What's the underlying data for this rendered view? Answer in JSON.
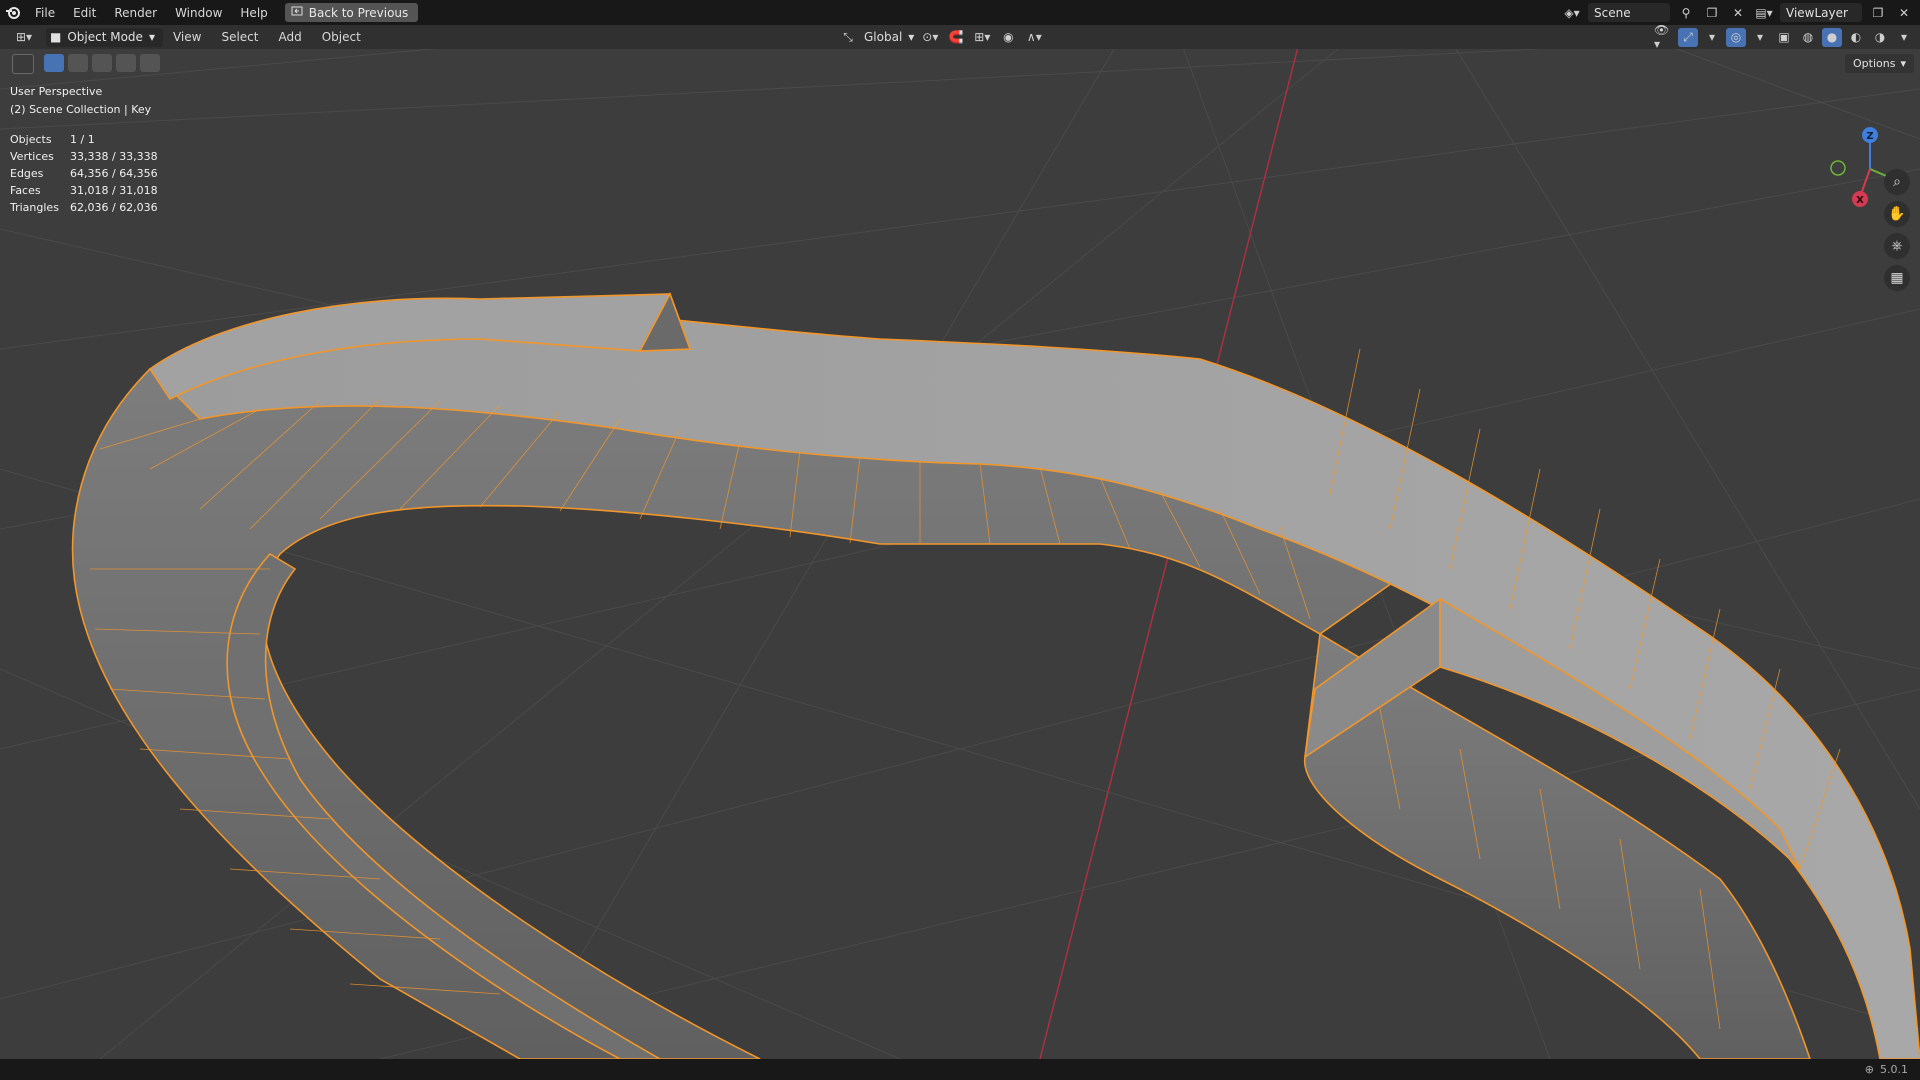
{
  "menu": {
    "items": [
      "File",
      "Edit",
      "Render",
      "Window",
      "Help"
    ],
    "back_label": "Back to Previous"
  },
  "top_right": {
    "scene_name": "Scene",
    "view_layer": "ViewLayer"
  },
  "header": {
    "mode": "Object Mode",
    "menus": [
      "View",
      "Select",
      "Add",
      "Object"
    ],
    "orientation": "Global"
  },
  "viewport": {
    "perspective": "User Perspective",
    "collection": "(2) Scene Collection | Key",
    "options_label": "Options",
    "stats": [
      {
        "label": "Objects",
        "value": "1 / 1"
      },
      {
        "label": "Vertices",
        "value": "33,338 / 33,338"
      },
      {
        "label": "Edges",
        "value": "64,356 / 64,356"
      },
      {
        "label": "Faces",
        "value": "31,018 / 31,018"
      },
      {
        "label": "Triangles",
        "value": "62,036 / 62,036"
      }
    ],
    "gizmo": {
      "x": "X",
      "y": "Y",
      "z": "Z"
    }
  },
  "status": {
    "version": "5.0.1"
  },
  "colors": {
    "selection": "#f0962b",
    "x_axis": "#c4303c",
    "accent": "#4772b3"
  }
}
